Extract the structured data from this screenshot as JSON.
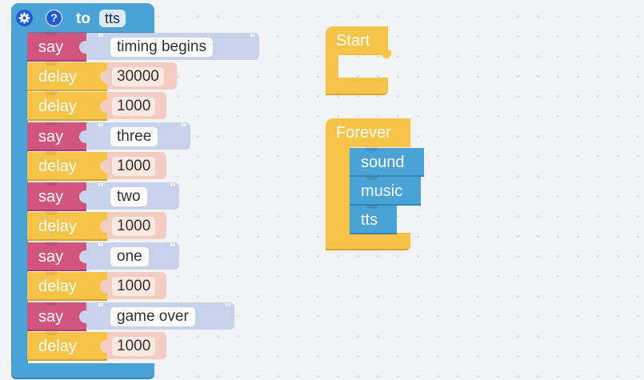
{
  "procedure": {
    "keyword": "to",
    "name": "tts",
    "settings_icon": "gear-icon",
    "help_icon": "question-mark-icon",
    "help_glyph": "?",
    "statements": [
      {
        "type": "say",
        "keyword": "say",
        "value": "timing begins"
      },
      {
        "type": "delay",
        "keyword": "delay",
        "value": "30000"
      },
      {
        "type": "delay",
        "keyword": "delay",
        "value": "1000"
      },
      {
        "type": "say",
        "keyword": "say",
        "value": "three"
      },
      {
        "type": "delay",
        "keyword": "delay",
        "value": "1000"
      },
      {
        "type": "say",
        "keyword": "say",
        "value": "two"
      },
      {
        "type": "delay",
        "keyword": "delay",
        "value": "1000"
      },
      {
        "type": "say",
        "keyword": "say",
        "value": "one"
      },
      {
        "type": "delay",
        "keyword": "delay",
        "value": "1000"
      },
      {
        "type": "say",
        "keyword": "say",
        "value": "game over"
      },
      {
        "type": "delay",
        "keyword": "delay",
        "value": "1000"
      }
    ]
  },
  "start_block": {
    "label": "Start"
  },
  "forever_block": {
    "label": "Forever",
    "calls": [
      {
        "label": "sound"
      },
      {
        "label": "music"
      },
      {
        "label": "tts"
      }
    ]
  },
  "colors": {
    "procedure": "#4aa3d4",
    "say": "#d2557f",
    "delay": "#f7c44a",
    "event": "#f7c44a",
    "workspace": "#f1f3f5"
  }
}
